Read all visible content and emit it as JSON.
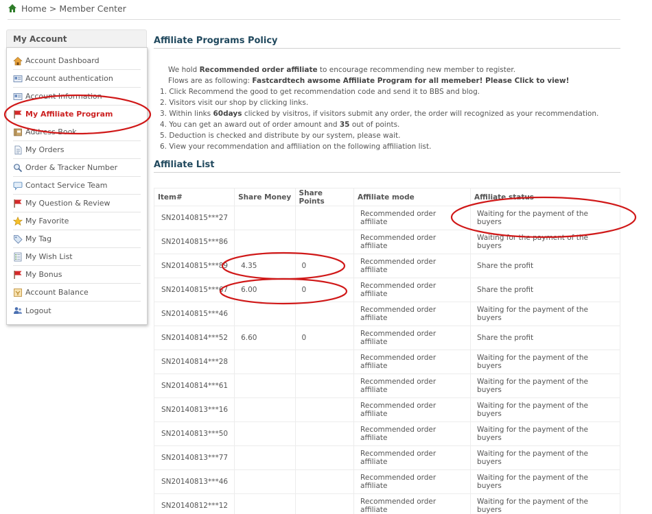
{
  "breadcrumb": {
    "home": "Home",
    "separator": ">",
    "current": "Member Center"
  },
  "sidebar": {
    "title": "My Account",
    "items": [
      {
        "label": "Account Dashboard",
        "icon": "house-icon"
      },
      {
        "label": "Account authentication",
        "icon": "id-card-icon"
      },
      {
        "label": "Account Information",
        "icon": "id-card-icon"
      },
      {
        "label": "My Affiliate Program",
        "icon": "flag-icon"
      },
      {
        "label": "Address Book",
        "icon": "book-icon"
      },
      {
        "label": "My Orders",
        "icon": "document-icon"
      },
      {
        "label": "Order & Tracker Number",
        "icon": "magnifier-icon"
      },
      {
        "label": "Contact Service Team",
        "icon": "speech-bubble-icon"
      },
      {
        "label": "My Question & Review",
        "icon": "flag-icon"
      },
      {
        "label": "My Favorite",
        "icon": "star-icon"
      },
      {
        "label": "My Tag",
        "icon": "tag-icon"
      },
      {
        "label": "My Wish List",
        "icon": "list-icon"
      },
      {
        "label": "My Bonus",
        "icon": "flag-icon"
      },
      {
        "label": "Account Balance",
        "icon": "balance-icon"
      },
      {
        "label": "Logout",
        "icon": "users-icon"
      }
    ],
    "active_index": 3
  },
  "policy": {
    "title": "Affiliate Programs Policy",
    "intro_pre": "We hold ",
    "intro_bold": "Recommended order affiliate",
    "intro_post": " to encourage recommending new member to register.",
    "flows_pre": "Flows are as following: ",
    "flows_bold": "Fastcardtech awsome Affiliate Program for all memeber! Please Click to view!",
    "step1": "1. Click Recommend the good to get recommendation code and send it to BBS and blog.",
    "step2": "2. Visitors visit our shop by clicking links.",
    "step3_pre": "3. Within links ",
    "step3_bold": "60days",
    "step3_post": " clicked by visitros, if visitors submit any order, the order will recognized as your recommendation.",
    "step4_pre": "4. You can get an award out of order amount and ",
    "step4_bold": "35",
    "step4_post": " out of points.",
    "step5": "5. Deduction is checked and distribute by our system, please wait.",
    "step6": "6. View your recommendation and affiliation on the following affiliation list."
  },
  "affiliate_list": {
    "title": "Affiliate List",
    "headers": {
      "item": "Item#",
      "money": "Share Money",
      "points": "Share Points",
      "mode": "Affiliate mode",
      "status": "Affiliate status"
    },
    "rows": [
      {
        "item": "SN20140815***27",
        "money": "",
        "points": "",
        "mode": "Recommended order affiliate",
        "status": "Waiting for the payment of the buyers"
      },
      {
        "item": "SN20140815***86",
        "money": "",
        "points": "",
        "mode": "Recommended order affiliate",
        "status": "Waiting for the payment of the buyers"
      },
      {
        "item": "SN20140815***89",
        "money": "4.35",
        "points": "0",
        "mode": "Recommended order affiliate",
        "status": "Share the profit"
      },
      {
        "item": "SN20140815***67",
        "money": "6.00",
        "points": "0",
        "mode": "Recommended order affiliate",
        "status": "Share the profit"
      },
      {
        "item": "SN20140815***46",
        "money": "",
        "points": "",
        "mode": "Recommended order affiliate",
        "status": "Waiting for the payment of the buyers"
      },
      {
        "item": "SN20140814***52",
        "money": "6.60",
        "points": "0",
        "mode": "Recommended order affiliate",
        "status": "Share the profit"
      },
      {
        "item": "SN20140814***28",
        "money": "",
        "points": "",
        "mode": "Recommended order affiliate",
        "status": "Waiting for the payment of the buyers"
      },
      {
        "item": "SN20140814***61",
        "money": "",
        "points": "",
        "mode": "Recommended order affiliate",
        "status": "Waiting for the payment of the buyers"
      },
      {
        "item": "SN20140813***16",
        "money": "",
        "points": "",
        "mode": "Recommended order affiliate",
        "status": "Waiting for the payment of the buyers"
      },
      {
        "item": "SN20140813***50",
        "money": "",
        "points": "",
        "mode": "Recommended order affiliate",
        "status": "Waiting for the payment of the buyers"
      },
      {
        "item": "SN20140813***77",
        "money": "",
        "points": "",
        "mode": "Recommended order affiliate",
        "status": "Waiting for the payment of the buyers"
      },
      {
        "item": "SN20140813***46",
        "money": "",
        "points": "",
        "mode": "Recommended order affiliate",
        "status": "Waiting for the payment of the buyers"
      },
      {
        "item": "SN20140812***12",
        "money": "",
        "points": "",
        "mode": "Recommended order affiliate",
        "status": "Waiting for the payment of the buyers"
      }
    ]
  },
  "colors": {
    "annotation_red": "#d01818",
    "title_blue": "#21495e",
    "active_red": "#cc2222"
  }
}
